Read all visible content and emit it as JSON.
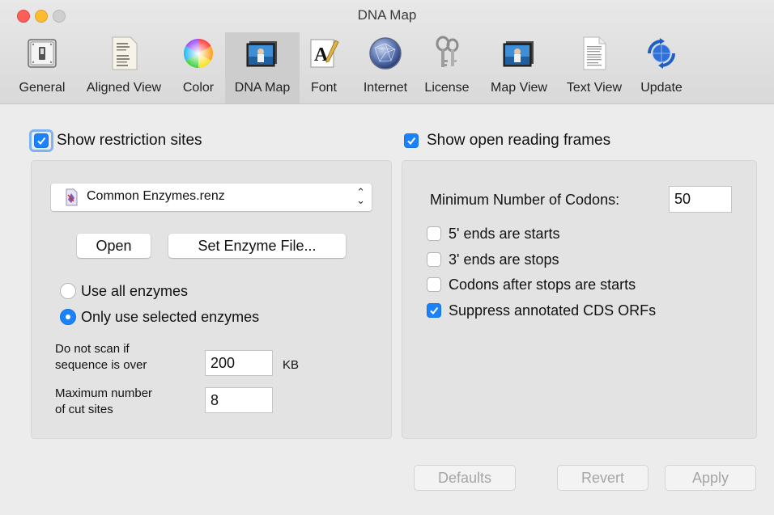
{
  "window": {
    "title": "DNA Map"
  },
  "toolbar": {
    "items": [
      {
        "label": "General",
        "icon": "switch-icon"
      },
      {
        "label": "Aligned View",
        "icon": "aligned-sequence-icon"
      },
      {
        "label": "Color",
        "icon": "color-wheel-icon"
      },
      {
        "label": "DNA Map",
        "icon": "picture-icon",
        "selected": true
      },
      {
        "label": "Font",
        "icon": "font-icon"
      },
      {
        "label": "Internet",
        "icon": "globe-icon"
      },
      {
        "label": "License",
        "icon": "keys-icon"
      },
      {
        "label": "Map View",
        "icon": "picture-icon"
      },
      {
        "label": "Text View",
        "icon": "document-icon"
      },
      {
        "label": "Update",
        "icon": "sync-globe-icon"
      }
    ]
  },
  "restriction": {
    "title": "Show restriction sites",
    "checked": true,
    "enzyme_file": "Common Enzymes.renz",
    "open_button": "Open",
    "set_file_button": "Set Enzyme File...",
    "use_all_label": "Use all enzymes",
    "only_selected_label": "Only use selected enzymes",
    "selected_option": "only_selected",
    "no_scan_label_1": "Do not scan if",
    "no_scan_label_2": "sequence is over",
    "no_scan_value": "200",
    "no_scan_unit": "KB",
    "max_cut_label_1": "Maximum number",
    "max_cut_label_2": "of cut sites",
    "max_cut_value": "8"
  },
  "orf": {
    "title": "Show open reading frames",
    "checked": true,
    "min_codons_label": "Minimum Number of Codons:",
    "min_codons_value": "50",
    "options": [
      {
        "label": "5' ends are starts",
        "checked": false
      },
      {
        "label": "3' ends are stops",
        "checked": false
      },
      {
        "label": "Codons after stops are starts",
        "checked": false
      },
      {
        "label": "Suppress annotated CDS ORFs",
        "checked": true
      }
    ]
  },
  "footer": {
    "defaults": "Defaults",
    "revert": "Revert",
    "apply": "Apply"
  },
  "colors": {
    "accent": "#1a82fb",
    "close": "#fc5f57",
    "minimize": "#fdbc2e",
    "zoom": "#cfcfcf"
  }
}
